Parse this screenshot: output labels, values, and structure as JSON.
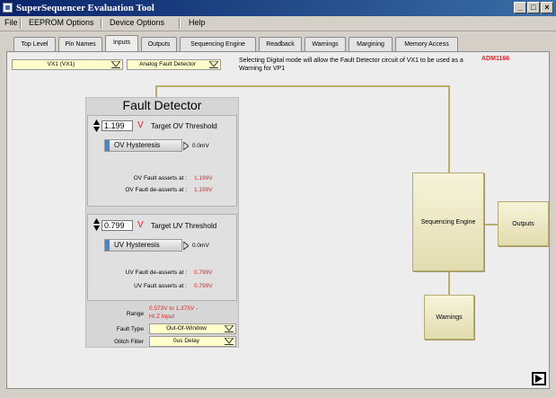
{
  "window": {
    "title": "SuperSequencer Evaluation Tool",
    "controls": [
      "_",
      "□",
      "×"
    ]
  },
  "menu": [
    "File",
    "EEPROM Options",
    "Device Options",
    "Help"
  ],
  "tabs": [
    "Top Level",
    "Pin Names",
    "Inputs",
    "Outputs",
    "Sequencing Engine",
    "Readback",
    "Warnings",
    "Margining",
    "Memory Access"
  ],
  "active_tab": "Inputs",
  "inputs": {
    "channel_select": "VX1  (VX1)",
    "mode_select": "Analog Fault Detector",
    "info_text": "Selecting Digital mode will allow the Fault Detector circuit of VX1 to be used as a Warning for VP1",
    "brand": "ADM1166"
  },
  "fault_detector": {
    "title": "Fault Detector",
    "ov": {
      "value": "1.199",
      "unit": "V",
      "label": "Target OV Threshold",
      "hysteresis_label": "OV Hysteresis",
      "hysteresis_value": "0.0mV",
      "assert_label": "OV Fault asserts at :",
      "assert_value": "1.199V",
      "deassert_label": "OV Fault de-asserts at :",
      "deassert_value": "1.199V"
    },
    "uv": {
      "value": "0.799",
      "unit": "V",
      "label": "Target UV Threshold",
      "hysteresis_label": "UV Hysteresis",
      "hysteresis_value": "0.0mV",
      "deassert_label": "UV Fault de-asserts at :",
      "deassert_value": "0.799V",
      "assert_label": "UV Fault asserts at :",
      "assert_value": "0.799V"
    },
    "range_label": "Range",
    "range_value_line1": "0.573V to 1.375V -",
    "range_value_line2": "Hi Z Input",
    "fault_type_label": "Fault Type",
    "fault_type_value": "Out-Of-Window",
    "glitch_filter_label": "Glitch Filter",
    "glitch_filter_value": "0us Delay"
  },
  "diagram": {
    "sequencing_engine": "Sequencing Engine",
    "outputs": "Outputs",
    "warnings": "Warnings"
  },
  "colors": {
    "accent_red": "#e82020",
    "dropdown_bg": "#ffffcc",
    "block_bg": "#efe9c4",
    "connector": "#b9ad6a"
  }
}
